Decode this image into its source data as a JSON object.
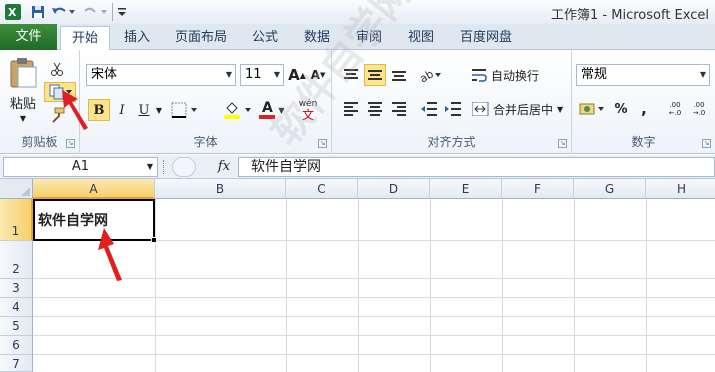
{
  "window": {
    "title": "工作簿1 - Microsoft Excel"
  },
  "tabs": {
    "file": "文件",
    "home": "开始",
    "insert": "插入",
    "page_layout": "页面布局",
    "formulas": "公式",
    "data": "数据",
    "review": "审阅",
    "view": "视图",
    "baidu": "百度网盘"
  },
  "clipboard": {
    "paste_label": "粘贴",
    "group_label": "剪贴板"
  },
  "font": {
    "name": "宋体",
    "size": "11",
    "bold": "B",
    "italic": "I",
    "underline": "U",
    "font_color_glyph": "A",
    "wen_glyph": "wén",
    "group_label": "字体"
  },
  "alignment": {
    "wrap_text": "自动换行",
    "merge_center": "合并后居中",
    "group_label": "对齐方式"
  },
  "number": {
    "format": "常规",
    "percent": "%",
    "comma": ",",
    "inc_decimal": ".00",
    "dec_decimal": ".00",
    "group_label": "数字"
  },
  "formula_bar": {
    "name_box": "A1",
    "fx": "fx",
    "value": "软件自学网"
  },
  "grid": {
    "columns": [
      "A",
      "B",
      "C",
      "D",
      "E",
      "F",
      "G",
      "H"
    ],
    "rows": [
      "1",
      "2",
      "3",
      "4",
      "5",
      "6",
      "7"
    ],
    "cells": {
      "A1": "软件自学网"
    }
  },
  "watermark": "软件自学网",
  "colors": {
    "file_tab": "#2a7a2f",
    "highlight": "#fde38a",
    "arrow": "#e02020"
  }
}
